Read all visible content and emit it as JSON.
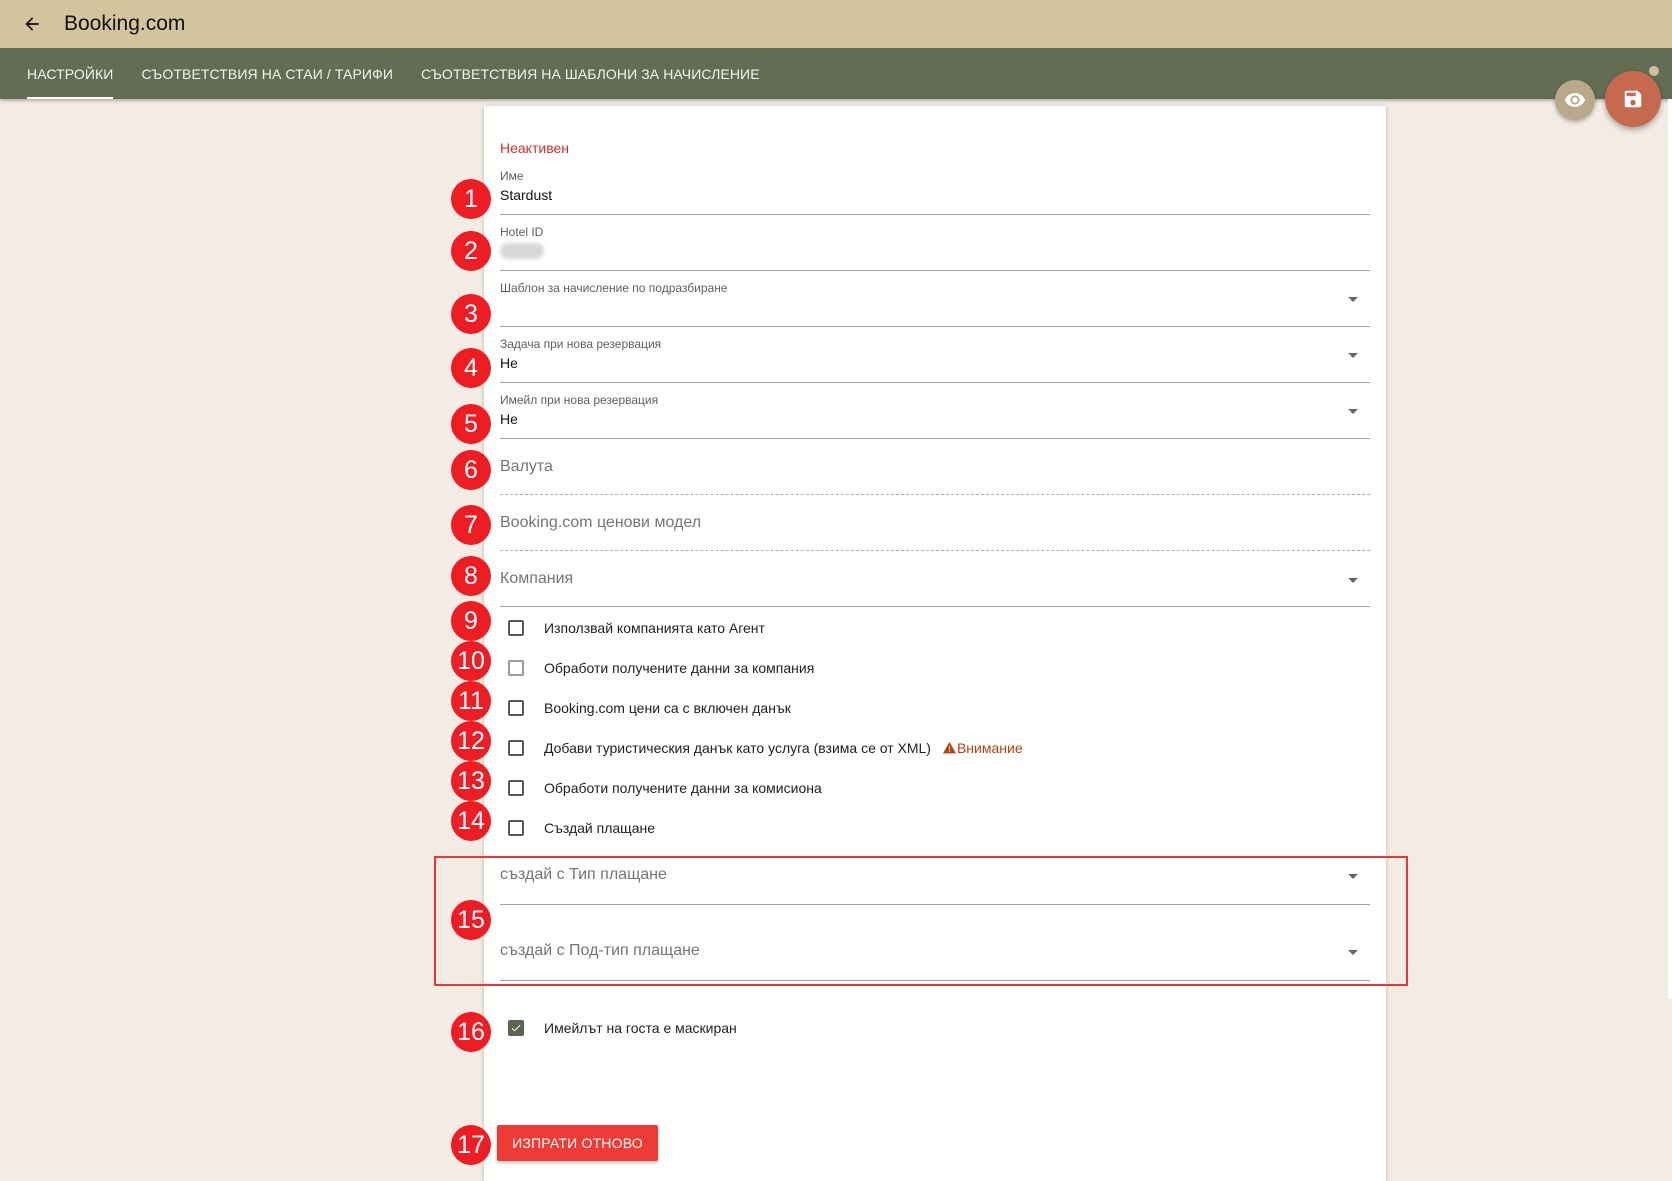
{
  "header": {
    "title": "Booking.com",
    "back_icon": "arrow-left-icon"
  },
  "tabs": [
    {
      "label": "НАСТРОЙКИ",
      "active": true
    },
    {
      "label": "СЪОТВЕТСТВИЯ НА СТАИ / ТАРИФИ",
      "active": false
    },
    {
      "label": "СЪОТВЕТСТВИЯ НА ШАБЛОНИ ЗА НАЧИСЛЕНИЕ",
      "active": false
    }
  ],
  "actions": {
    "view_icon": "eye-icon",
    "save_icon": "floppy-disk-icon"
  },
  "form": {
    "status": "Неактивен",
    "name": {
      "label": "Име",
      "value": "Stardust"
    },
    "hotel_id": {
      "label": "Hotel ID",
      "value": ""
    },
    "charge_template": {
      "label": "Шаблон за начисление по подразбиране",
      "value": ""
    },
    "task_new_reservation": {
      "label": "Задача при нова резервация",
      "value": "Не"
    },
    "email_new_reservation": {
      "label": "Имейл при нова резервация",
      "value": "Не"
    },
    "currency": {
      "placeholder": "Валута"
    },
    "price_model": {
      "placeholder": "Booking.com ценови модел"
    },
    "company": {
      "placeholder": "Компания"
    },
    "checkboxes": [
      {
        "label": "Използвай компанията като Агент",
        "checked": false,
        "disabled": false
      },
      {
        "label": "Обработи получените данни за компания",
        "checked": false,
        "disabled": true
      },
      {
        "label": "Booking.com цени са с включен данък",
        "checked": false,
        "disabled": false
      },
      {
        "label": "Добави туристическия данък като услуга (взима се от XML)",
        "checked": false,
        "disabled": false
      },
      {
        "label": "Обработи получените данни за комисиона",
        "checked": false,
        "disabled": false
      },
      {
        "label": "Създай плащане",
        "checked": false,
        "disabled": false
      }
    ],
    "warning": "Внимание",
    "payment_type": {
      "placeholder": "създай с Тип плащане"
    },
    "payment_subtype": {
      "placeholder": "създай с Под-тип плащане"
    },
    "masked_email": {
      "label": "Имейлът на госта е маскиран",
      "checked": true
    },
    "resend_button": "ИЗПРАТИ ОТНОВО"
  },
  "markers": [
    "1",
    "2",
    "3",
    "4",
    "5",
    "6",
    "7",
    "8",
    "9",
    "10",
    "11",
    "12",
    "13",
    "14",
    "15",
    "16",
    "17"
  ],
  "colors": {
    "topbar": "#d4c49e",
    "tabbar": "#636d54",
    "background": "#f3ece4",
    "marker": "#ee1d23",
    "status_inactive": "#d32f2f",
    "save_fab": "#c66a4f",
    "button": "#ef3b36"
  }
}
